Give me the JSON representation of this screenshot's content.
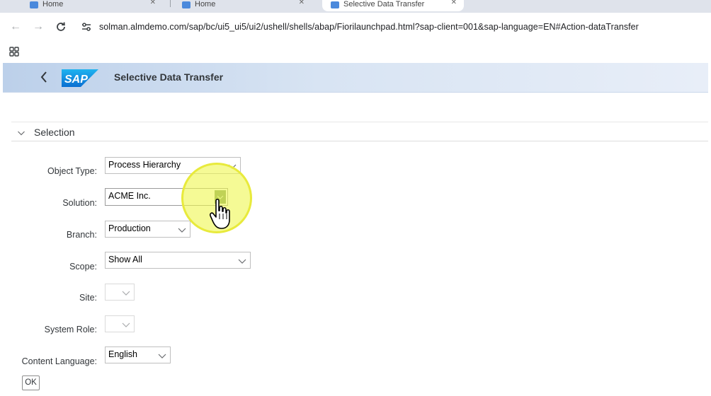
{
  "browser": {
    "tabs": [
      {
        "label": "Home",
        "active": false
      },
      {
        "label": "Home",
        "active": false
      },
      {
        "label": "Selective Data Transfer",
        "active": true
      }
    ],
    "url": "solman.almdemo.com/sap/bc/ui5_ui5/ui2/ushell/shells/abap/Fiorilaunchpad.html?sap-client=001&sap-language=EN#Action-dataTransfer"
  },
  "shell": {
    "logo_text": "SAP",
    "title": "Selective Data Transfer"
  },
  "section": {
    "title": "Selection"
  },
  "form": {
    "object_type": {
      "label": "Object Type:",
      "value": "Process Hierarchy"
    },
    "solution": {
      "label": "Solution:",
      "value": "ACME Inc."
    },
    "branch": {
      "label": "Branch:",
      "value": "Production"
    },
    "scope": {
      "label": "Scope:",
      "value": "Show All"
    },
    "site": {
      "label": "Site:",
      "value": ""
    },
    "system_role": {
      "label": "System Role:",
      "value": ""
    },
    "content_language": {
      "label": "Content Language:",
      "value": "English"
    }
  },
  "actions": {
    "ok_label": "OK"
  },
  "colors": {
    "shell_gradient_start": "#bcd0ea",
    "sap_blue": "#0a6ed1",
    "combo_button": "#7a9b62",
    "highlight": "#eef74e"
  },
  "icons": [
    "back-icon",
    "forward-icon",
    "reload-icon",
    "site-info-icon",
    "apps-icon",
    "shell-back-icon",
    "chevron-down-icon",
    "hand-cursor-icon"
  ]
}
